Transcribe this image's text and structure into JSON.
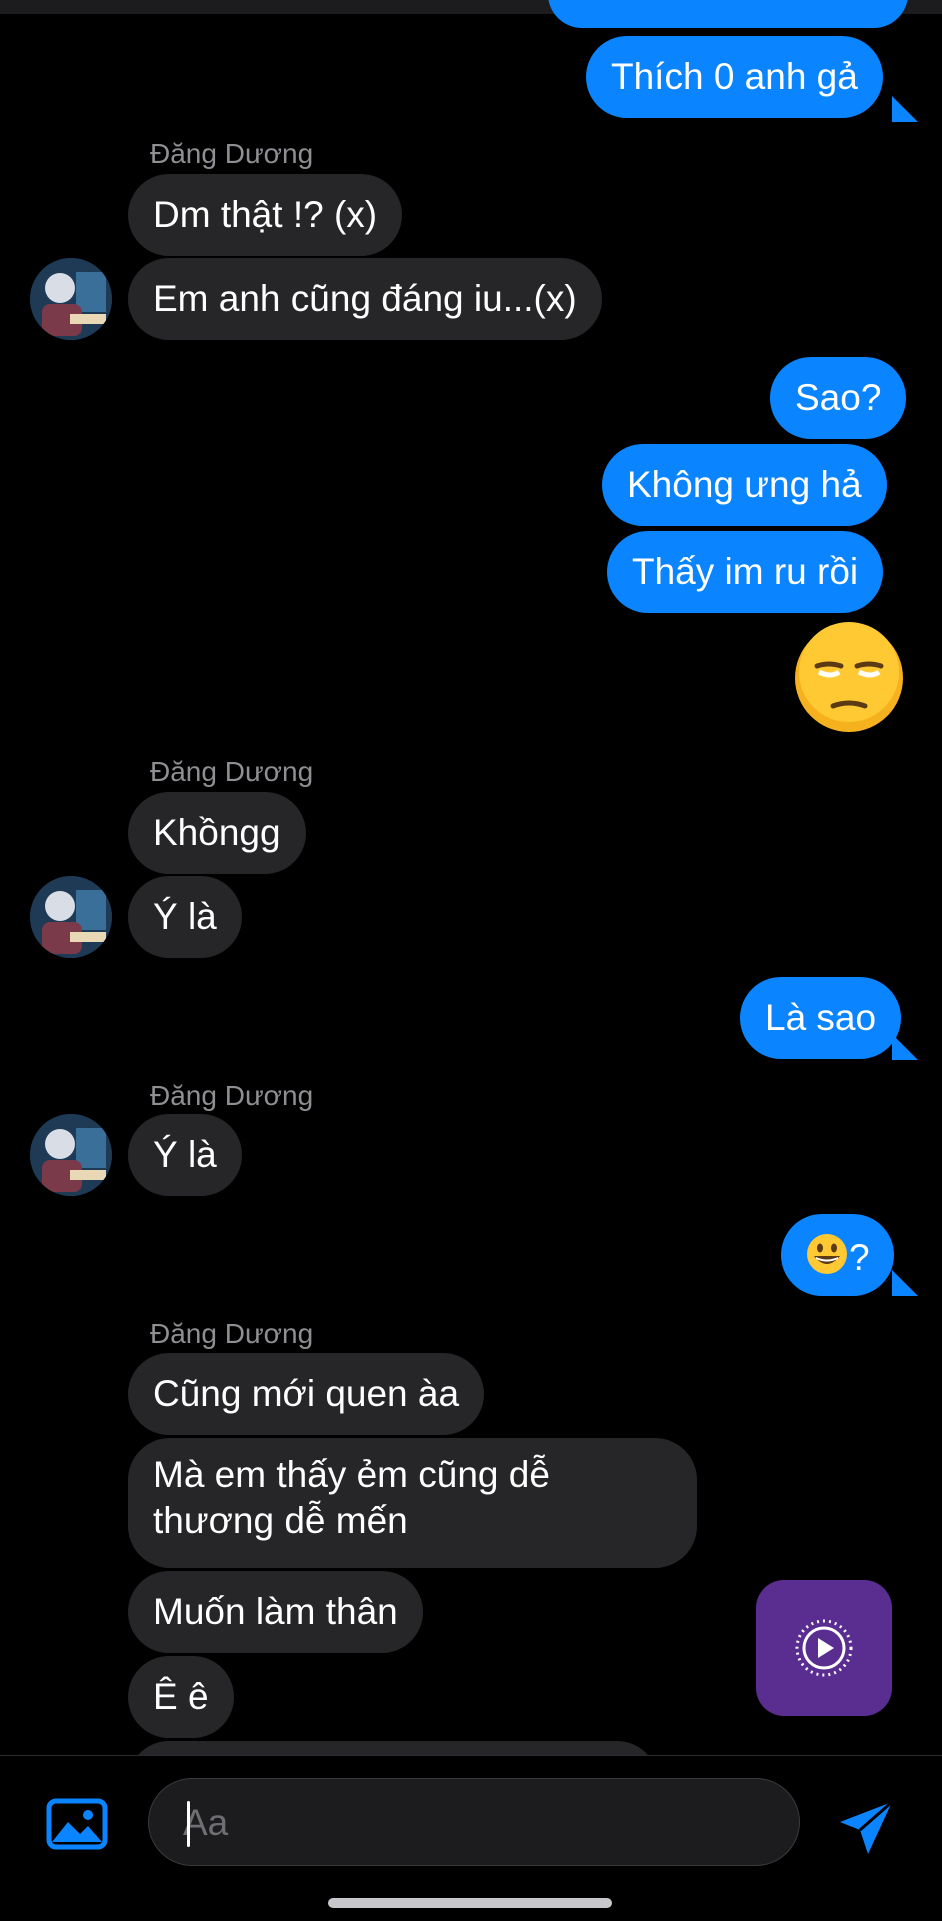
{
  "conversation": {
    "sender_name": "Đăng Dương",
    "messages": [
      {
        "dir": "out",
        "text": "Thích 0 anh gả"
      },
      {
        "dir": "in",
        "text": "Dm thật !? (x)"
      },
      {
        "dir": "in",
        "text": "Em anh cũng đáng iu...(x)"
      },
      {
        "dir": "out",
        "text": "Sao?"
      },
      {
        "dir": "out",
        "text": "Không ưng hả"
      },
      {
        "dir": "out",
        "text": "Thấy im ru rồi"
      },
      {
        "dir": "out",
        "text": "😒"
      },
      {
        "dir": "in",
        "text": "Khồngg"
      },
      {
        "dir": "in",
        "text": "Ý là"
      },
      {
        "dir": "out",
        "text": "Là sao"
      },
      {
        "dir": "in",
        "text": "Ý là"
      },
      {
        "dir": "out",
        "text": "😀?"
      },
      {
        "dir": "in",
        "text": "Cũng mới quen àa"
      },
      {
        "dir": "in",
        "text": "Mà em thấy ẻm cũng dễ"
      },
      {
        "dir": "in",
        "text": "thương dễ mến"
      },
      {
        "dir": "in",
        "text": "Muốn làm thân"
      },
      {
        "dir": "in",
        "text": "Ê ê"
      }
    ]
  },
  "composer": {
    "placeholder": "Aa",
    "gallery_icon": "image-icon",
    "send_icon": "send-icon"
  },
  "floating_button": {
    "icon": "play-circle-icon"
  },
  "colors": {
    "background": "#000000",
    "outgoing_bubble": "#0a84ff",
    "incoming_bubble": "#262628",
    "sender_name": "#8e8e93",
    "floating_button": "#5a2d91"
  }
}
